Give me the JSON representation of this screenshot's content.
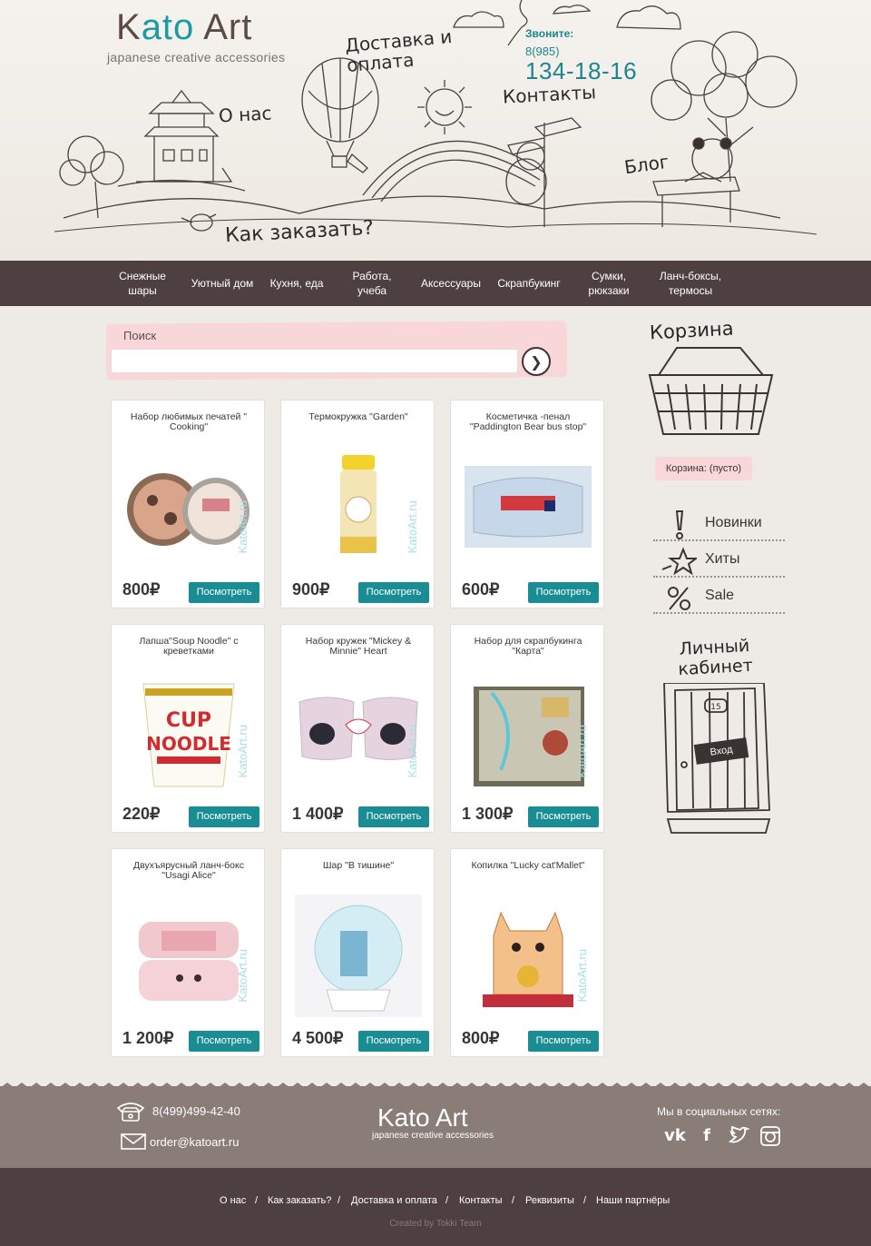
{
  "header": {
    "logo_main_1": "K",
    "logo_main_2": "ato",
    "logo_main_3": " Art",
    "logo_sub": "japanese creative accessories",
    "call_label": "Звоните:",
    "call_prefix": "8(985)",
    "call_number": "134-18-16",
    "links": {
      "delivery": "Доставка и оплата",
      "about": "О нас",
      "contacts": "Контакты",
      "blog": "Блог",
      "how_to_order": "Как заказать?"
    }
  },
  "nav": {
    "items": [
      {
        "label": "Снежные шары"
      },
      {
        "label": "Уютный дом"
      },
      {
        "label": "Кухня, еда"
      },
      {
        "label": "Работа, учеба"
      },
      {
        "label": "Аксессуары"
      },
      {
        "label": "Скрапбукинг"
      },
      {
        "label": "Сумки, рюкзаки"
      },
      {
        "label": "Ланч-боксы, термосы"
      }
    ]
  },
  "search": {
    "label": "Поиск",
    "value": "",
    "placeholder": ""
  },
  "products": [
    {
      "title": "Набор любимых печатей \" Cooking\"",
      "price": "800₽",
      "button": "Посмотреть",
      "watermark": "KatoArt.ru"
    },
    {
      "title": "Термокружка \"Garden\"",
      "price": "900₽",
      "button": "Посмотреть",
      "watermark": "KatoArt.ru"
    },
    {
      "title": "Косметичка -пенал \"Paddington Bear bus stop\"",
      "price": "600₽",
      "button": "Посмотреть",
      "watermark": ""
    },
    {
      "title": "Лапша\"Soup Noodle\" с креветками",
      "price": "220₽",
      "button": "Посмотреть",
      "watermark": "KatoArt.ru"
    },
    {
      "title": "Набор кружек \"Mickey & Minnie\" Heart",
      "price": "1 400₽",
      "button": "Посмотреть",
      "watermark": "KatoArt.ru"
    },
    {
      "title": "Набор для скрапбукинга \"Карта\"",
      "price": "1 300₽",
      "button": "Посмотреть",
      "watermark": "KatoArt.ru"
    },
    {
      "title": "Двухъярусный ланч-бокс \"Usagi Alice\"",
      "price": "1 200₽",
      "button": "Посмотреть",
      "watermark": "KatoArt.ru"
    },
    {
      "title": "Шар \"В тишине\"",
      "price": "4 500₽",
      "button": "Посмотреть",
      "watermark": ""
    },
    {
      "title": "Копилка \"Lucky cat'Mallet\"",
      "price": "800₽",
      "button": "Посмотреть",
      "watermark": "KatoArt.ru"
    }
  ],
  "sidebar": {
    "cart_title": "Корзина",
    "cart_status": "Корзина: (пусто)",
    "items": [
      {
        "label": "Новинки",
        "icon": "exclamation-icon"
      },
      {
        "label": "Хиты",
        "icon": "star-icon"
      },
      {
        "label": "Sale",
        "icon": "percent-icon"
      }
    ],
    "cabinet_title": "Личный кабинет",
    "door_number": "15",
    "login_label": "Вход"
  },
  "footer": {
    "phone": "8(499)499-42-40",
    "email": "order@katoart.ru",
    "logo": "Kato Art",
    "logo_sub": "japanese creative accessories",
    "social_label": "Мы в социальных сетях:",
    "social": [
      "vk-icon",
      "facebook-icon",
      "twitter-icon",
      "instagram-icon"
    ],
    "links": [
      "О нас",
      "Как заказать?",
      "Доставка и оплата",
      "Контакты",
      "Реквизиты",
      "Наши партнёры"
    ],
    "separator": "/",
    "credit": "Created by Tokki Team"
  },
  "colors": {
    "accent": "#1a8d94",
    "nav_bg": "#4e4040",
    "pink": "#f9d6d8",
    "footer_top": "#8a7d77",
    "page_bg": "#eeebe6"
  }
}
